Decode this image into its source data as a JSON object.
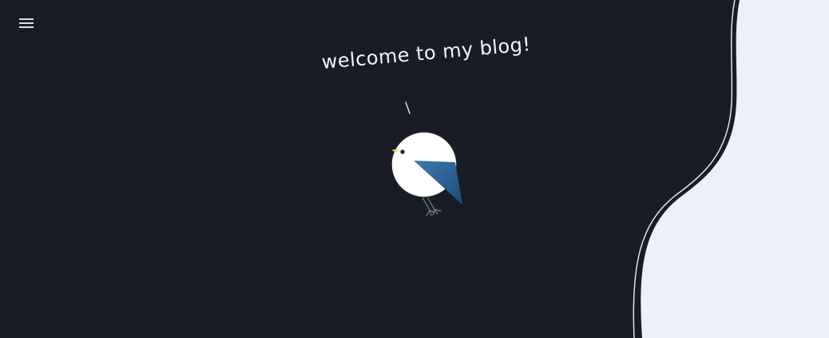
{
  "header": {
    "menu_icon": "hamburger-menu-icon"
  },
  "hero": {
    "greeting": "welcome to my blog!",
    "illustration": "bird-icon"
  },
  "colors": {
    "background": "#191c24",
    "panel": "#edf0f6",
    "bird_body": "#ffffff",
    "wing_top": "#3c7ab0",
    "wing_bottom": "#1f4b7a",
    "beak": "#e8e23a",
    "text": "#f4f5f8"
  }
}
